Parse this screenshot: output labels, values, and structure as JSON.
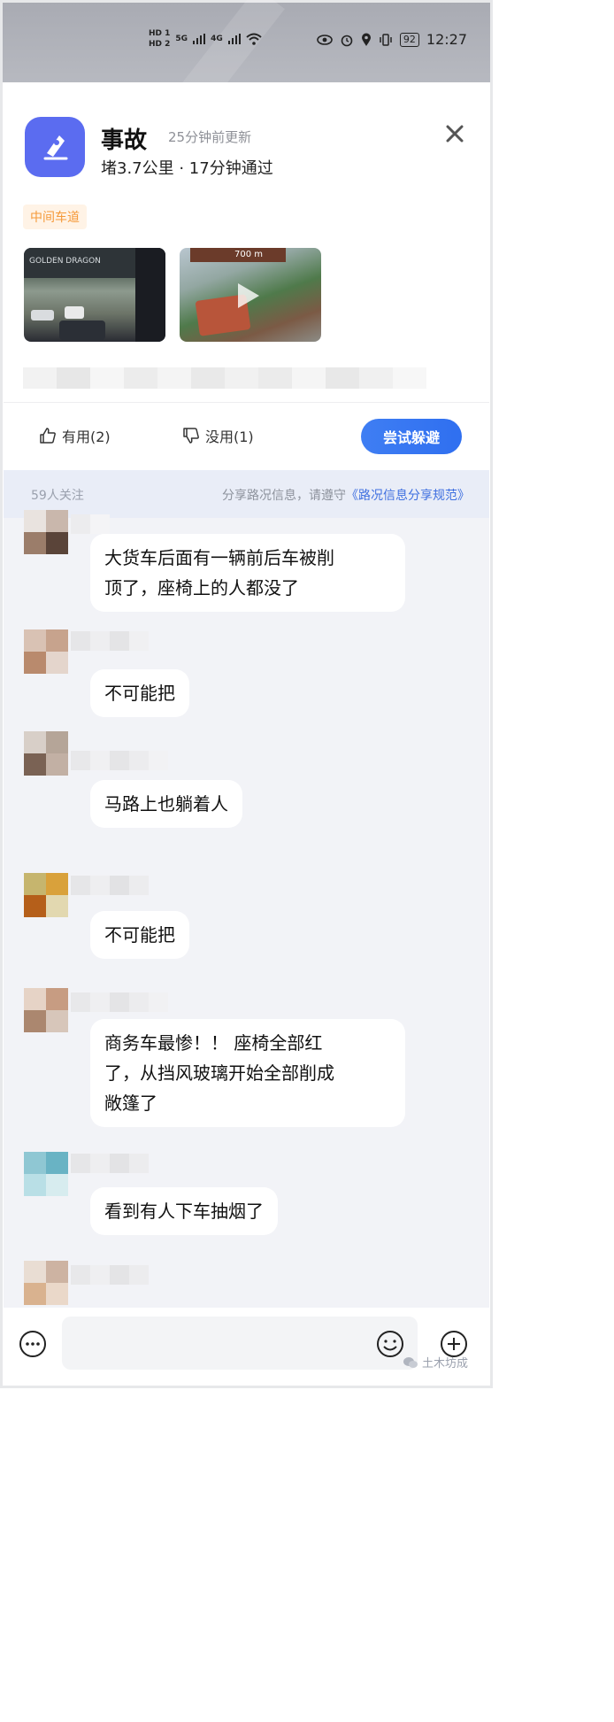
{
  "status_bar": {
    "sim1": "HD 1",
    "sim2": "HD 2",
    "net1": "5G",
    "net2": "4G",
    "battery": "92",
    "time": "12:27"
  },
  "event": {
    "title": "事故",
    "updated": "25分钟前更新",
    "summary": "堵3.7公里 · 17分钟通过",
    "lane_tag": "中间车道",
    "thumb1_label": "GOLDEN DRAGON",
    "thumb2_label": "700 m"
  },
  "actions": {
    "useful": "有用(2)",
    "useless": "没用(1)",
    "avoid": "尝试躲避"
  },
  "notice": {
    "followers": "59人关注",
    "rule_prefix": "分享路况信息，请遵守",
    "rule_link": "《路况信息分享规范》"
  },
  "comments": [
    {
      "text": "大货车后面有一辆前后车被削\n顶了，座椅上的人都没了",
      "colors": [
        "#e9e3df",
        "#c9b7ac",
        "#9b7d6a",
        "#5a4439"
      ]
    },
    {
      "text": "不可能把",
      "colors": [
        "#d9c2b4",
        "#c7a38d",
        "#b98a6d",
        "#e4d5cc"
      ]
    },
    {
      "text": "马路上也躺着人",
      "colors": [
        "#d8cfc8",
        "#b5a598",
        "#7a6254",
        "#c2b0a4"
      ]
    },
    {
      "text": "不可能把",
      "colors": [
        "#c6b56e",
        "#d9a13b",
        "#b55f1a",
        "#e2d8b0"
      ]
    },
    {
      "text": "商务车最惨！！ 座椅全部红\n了，从挡风玻璃开始全部削成\n敞篷了",
      "colors": [
        "#e6d3c6",
        "#c79c82",
        "#ab876f",
        "#d7c6ba"
      ]
    },
    {
      "text": "看到有人下车抽烟了",
      "colors": [
        "#8fc7d3",
        "#69b3c4",
        "#b9dfe6",
        "#d7ecef"
      ]
    }
  ],
  "input_bar": {
    "watermark": "土木坊成"
  },
  "colors": {
    "accent": "#3f7ef3",
    "tag_orange": "#f59a3a",
    "app_icon": "#5b6cf0"
  }
}
